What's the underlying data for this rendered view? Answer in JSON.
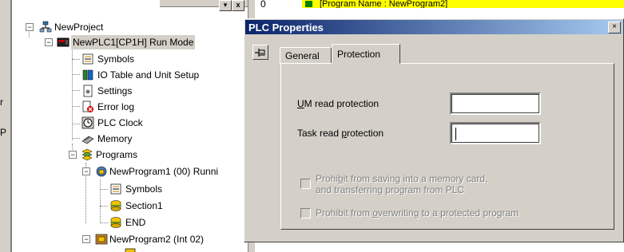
{
  "background": {
    "left_fragments": [
      "r",
      "P"
    ],
    "rung_number": "0",
    "program_banner": "[Program Name : NewProgram2]"
  },
  "tree": {
    "items": [
      {
        "label": "NewProject",
        "icon": "network-icon",
        "expander": "−"
      },
      {
        "label": "NewPLC1[CP1H] Run Mode",
        "icon": "plc-icon",
        "expander": "−"
      },
      {
        "label": "Symbols",
        "icon": "symbols-icon"
      },
      {
        "label": "IO Table and Unit Setup",
        "icon": "io-table-icon"
      },
      {
        "label": "Settings",
        "icon": "settings-icon"
      },
      {
        "label": "Error log",
        "icon": "error-log-icon"
      },
      {
        "label": "PLC Clock",
        "icon": "clock-icon"
      },
      {
        "label": "Memory",
        "icon": "memory-icon"
      },
      {
        "label": "Programs",
        "icon": "programs-icon",
        "expander": "−"
      },
      {
        "label": "NewProgram1 (00) Runni",
        "icon": "program-icon",
        "expander": "−"
      },
      {
        "label": "Symbols",
        "icon": "symbols-icon"
      },
      {
        "label": "Section1",
        "icon": "section-icon"
      },
      {
        "label": "END",
        "icon": "section-icon"
      },
      {
        "label": "NewProgram2 (Int 02)",
        "icon": "interrupt-program-icon",
        "expander": "−"
      }
    ]
  },
  "toolbar": {
    "min_label": "▾",
    "close_label": "x"
  },
  "dialog": {
    "title": "PLC Properties",
    "close_label": "×",
    "pin_icon": "pin-icon",
    "tabs": [
      {
        "label": "General",
        "active": false
      },
      {
        "label": "Protection",
        "active": true
      }
    ],
    "um_read": {
      "prefix": "U",
      "rest": "M read protection",
      "value": ""
    },
    "task_read": {
      "prefix": "Task read ",
      "accel": "p",
      "rest": "rotection",
      "value": ""
    },
    "prohibit_saving": {
      "pre": "Prohi",
      "accel": "b",
      "post": "it from saving into a memory card,",
      "line2": "and transferring program from PLC",
      "checked": false,
      "enabled": false
    },
    "prohibit_overwrite": {
      "pre": "Prohibit from ",
      "accel": "o",
      "post": "verwriting to a protected program",
      "checked": false,
      "enabled": false
    }
  },
  "colors": {
    "titlebar_start": "#0a246a",
    "titlebar_end": "#a6caf0",
    "banner": "#ffff00",
    "face": "#d4d0c8"
  }
}
